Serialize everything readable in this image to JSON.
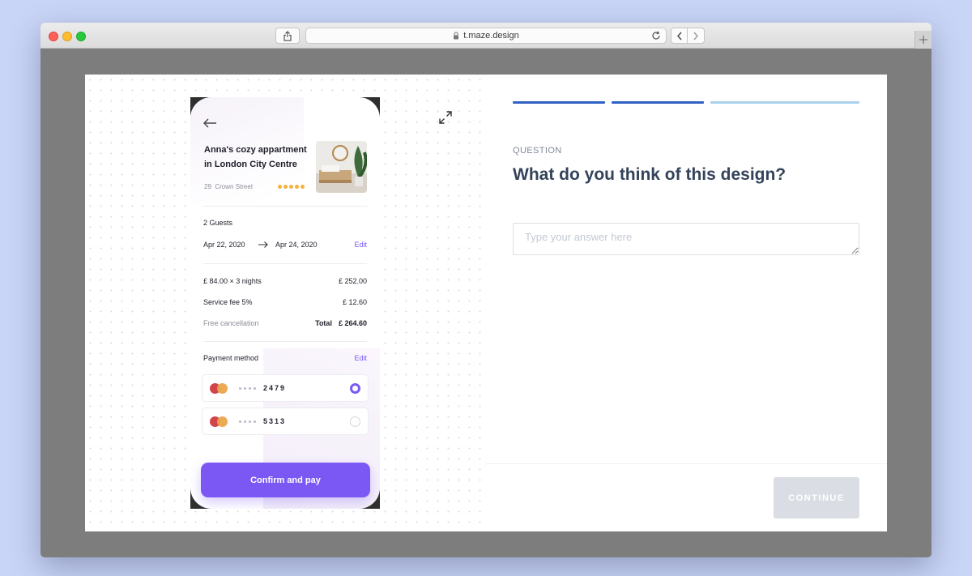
{
  "browser": {
    "url": "t.maze.design",
    "icons": {
      "share": "share-icon",
      "lock": "lock-icon",
      "reload": "reload-icon",
      "back": "chevron-left-icon",
      "forward": "chevron-right-icon",
      "new_tab": "plus-icon"
    }
  },
  "prototype": {
    "listing": {
      "title": "Anna's cozy appartment in London City Centre",
      "address_number": "29",
      "address_street": "Crown Street",
      "rating_dots": 5
    },
    "booking": {
      "guests": "2 Guests",
      "date_from": "Apr 22, 2020",
      "date_to": "Apr 24, 2020",
      "edit_label": "Edit"
    },
    "pricing": {
      "nights_label": "£ 84.00 × 3 nights",
      "nights_amount": "£ 252.00",
      "fee_label": "Service fee 5%",
      "fee_amount": "£ 12.60",
      "cancellation": "Free cancellation",
      "total_label": "Total",
      "total_amount": "£ 264.60"
    },
    "payment": {
      "label": "Payment method",
      "edit_label": "Edit",
      "cards": [
        {
          "last4": "2479",
          "selected": true
        },
        {
          "last4": "5313",
          "selected": false
        }
      ]
    },
    "confirm_label": "Confirm and pay"
  },
  "survey": {
    "progress": [
      {
        "state": "complete",
        "color": "#2f62c4"
      },
      {
        "state": "complete",
        "color": "#2f62c4"
      },
      {
        "state": "remaining",
        "color": "#a8d2ec"
      }
    ],
    "question_label": "QUESTION",
    "question_text": "What do you think of this design?",
    "answer_placeholder": "Type your answer here",
    "continue_label": "CONTINUE"
  },
  "colors": {
    "accent": "#7b58f4",
    "progress_done": "#2f62c4",
    "progress_todo": "#a8d2ec",
    "star": "#f3b33d"
  }
}
